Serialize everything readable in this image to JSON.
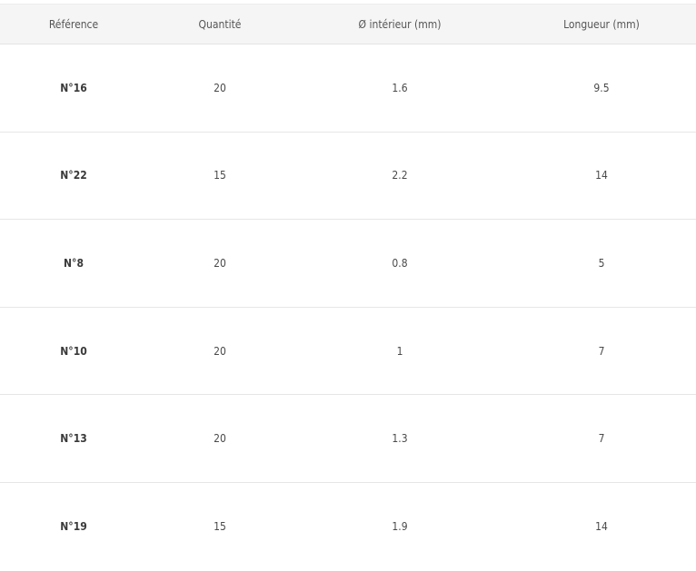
{
  "table": {
    "headers": [
      "Référence",
      "Quantité",
      "Ø intérieur (mm)",
      "Longueur (mm)"
    ],
    "rows": [
      [
        "N°16",
        "20",
        "1.6",
        "9.5"
      ],
      [
        "N°22",
        "15",
        "2.2",
        "14"
      ],
      [
        "N°8",
        "20",
        "0.8",
        "5"
      ],
      [
        "N°10",
        "20",
        "1",
        "7"
      ],
      [
        "N°13",
        "20",
        "1.3",
        "7"
      ],
      [
        "N°19",
        "15",
        "1.9",
        "14"
      ]
    ]
  }
}
